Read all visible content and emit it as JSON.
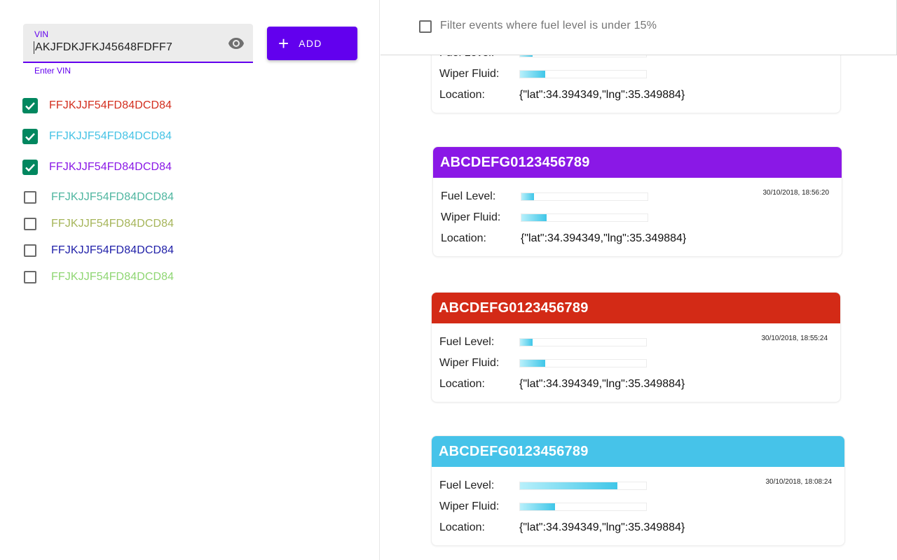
{
  "vin_input": {
    "label": "VIN",
    "value": "AKJFDKJFKJ45648FDFF7",
    "helper": "Enter VIN",
    "toggle_icon": "eye-icon"
  },
  "add_button": {
    "icon": "plus-icon",
    "label": "ADD"
  },
  "vin_list": [
    {
      "vin": "FFJKJJF54FD84DCD84",
      "checked": true,
      "color": "#d32f1f"
    },
    {
      "vin": "FFJKJJF54FD84DCD84",
      "checked": true,
      "color": "#46c3e5"
    },
    {
      "vin": "FFJKJJF54FD84DCD84",
      "checked": true,
      "color": "#8a18e6"
    },
    {
      "vin": "FFJKJJF54FD84DCD84",
      "checked": false,
      "color": "#4fb6a0"
    },
    {
      "vin": "FFJKJJF54FD84DCD84",
      "checked": false,
      "color": "#a6b55a"
    },
    {
      "vin": "FFJKJJF54FD84DCD84",
      "checked": false,
      "color": "#1f1fa8"
    },
    {
      "vin": "FFJKJJF54FD84DCD84",
      "checked": false,
      "color": "#8fd673"
    }
  ],
  "filter": {
    "label": "Filter events where fuel level is under 15%",
    "checked": false
  },
  "labels": {
    "fuel": "Fuel Level:",
    "wiper": "Wiper Fluid:",
    "location": "Location:"
  },
  "events": [
    {
      "title": "",
      "color": "#ffffff",
      "timestamp": "",
      "fuel_fraction": 0.1,
      "wiper_fraction": 0.2,
      "location": "{\"lat\":34.394349,\"lng\":35.349884}"
    },
    {
      "title": "ABCDEFG0123456789",
      "color": "#8a18e6",
      "timestamp": "30/10/2018, 18:56:20",
      "fuel_fraction": 0.1,
      "wiper_fraction": 0.2,
      "location": "{\"lat\":34.394349,\"lng\":35.349884}"
    },
    {
      "title": "ABCDEFG0123456789",
      "color": "#d32a16",
      "timestamp": "30/10/2018, 18:55:24",
      "fuel_fraction": 0.1,
      "wiper_fraction": 0.2,
      "location": "{\"lat\":34.394349,\"lng\":35.349884}"
    },
    {
      "title": "ABCDEFG0123456789",
      "color": "#46c3e9",
      "timestamp": "30/10/2018, 18:08:24",
      "fuel_fraction": 0.77,
      "wiper_fraction": 0.28,
      "location": "{\"lat\":34.394349,\"lng\":35.349884}"
    }
  ],
  "colors": {
    "accent": "#6200ee",
    "check": "#01875f"
  }
}
